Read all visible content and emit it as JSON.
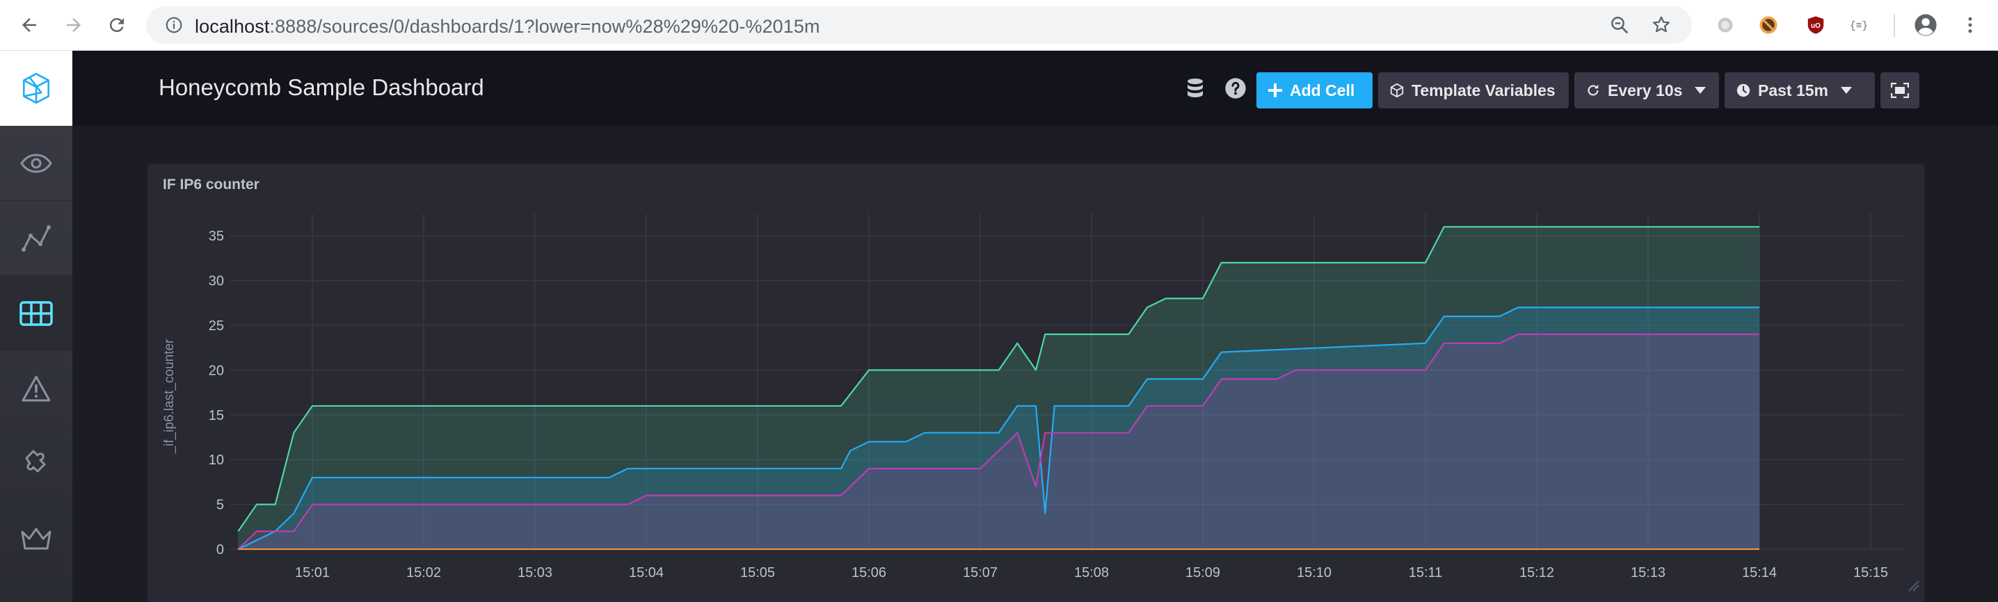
{
  "browser": {
    "url_host": "localhost",
    "url_rest": ":8888/sources/0/dashboards/1?lower=now%28%29%20-%2015m"
  },
  "header": {
    "title": "Honeycomb Sample Dashboard",
    "add_cell_label": "Add Cell",
    "template_variables_label": "Template Variables",
    "refresh_label": "Every 10s",
    "time_range_label": "Past 15m"
  },
  "sidebar": {
    "items": [
      {
        "icon": "eye-icon"
      },
      {
        "icon": "graph-icon"
      },
      {
        "icon": "dashboards-icon"
      },
      {
        "icon": "alert-icon"
      },
      {
        "icon": "puzzle-icon"
      },
      {
        "icon": "crown-icon"
      }
    ]
  },
  "colors": {
    "accent": "#22adf6",
    "series_green": "#4ed8a0",
    "series_blue": "#22adf6",
    "series_magenta": "#bf3bb3",
    "series_orange": "#f48d38"
  },
  "cell": {
    "title": "IF IP6 counter"
  },
  "chart_data": {
    "type": "area",
    "title": "IF IP6 counter",
    "xlabel": "",
    "ylabel": "_if_ip6.last_counter",
    "x_ticks": [
      "15:01",
      "15:02",
      "15:03",
      "15:04",
      "15:05",
      "15:06",
      "15:07",
      "15:08",
      "15:09",
      "15:10",
      "15:11",
      "15:12",
      "15:13",
      "15:14",
      "15:15"
    ],
    "y_ticks": [
      0,
      5,
      10,
      15,
      20,
      25,
      30,
      35
    ],
    "xlim": [
      "15:01:00",
      "15:15:00"
    ],
    "ylim": [
      0,
      37.5
    ],
    "grid": true,
    "legend": "none",
    "series": [
      {
        "color": "#4ed8a0",
        "x": [
          "15:01:20",
          "15:01:30",
          "15:01:40",
          "15:01:50",
          "15:02:00",
          "15:06:45",
          "15:07:00",
          "15:08:10",
          "15:08:20",
          "15:08:30",
          "15:08:35",
          "15:09:20",
          "15:09:30",
          "15:09:40",
          "15:10:00",
          "15:10:10",
          "15:12:00",
          "15:12:10",
          "15:15:00"
        ],
        "values": [
          2,
          5,
          5,
          13,
          16,
          16,
          20,
          20,
          23,
          20,
          24,
          24,
          27,
          28,
          28,
          32,
          32,
          36,
          36
        ]
      },
      {
        "color": "#22adf6",
        "x": [
          "15:01:20",
          "15:01:30",
          "15:01:40",
          "15:01:50",
          "15:02:00",
          "15:04:40",
          "15:04:50",
          "15:06:45",
          "15:06:50",
          "15:07:00",
          "15:07:20",
          "15:07:30",
          "15:08:10",
          "15:08:20",
          "15:08:30",
          "15:08:35",
          "15:08:40",
          "15:09:20",
          "15:09:30",
          "15:09:50",
          "15:10:00",
          "15:10:10",
          "15:12:00",
          "15:12:10",
          "15:12:40",
          "15:12:50",
          "15:15:00"
        ],
        "values": [
          0,
          1,
          2,
          4,
          8,
          8,
          9,
          9,
          11,
          12,
          12,
          13,
          13,
          16,
          16,
          4,
          16,
          16,
          19,
          19,
          19,
          22,
          23,
          26,
          26,
          27,
          27
        ]
      },
      {
        "color": "#bf3bb3",
        "x": [
          "15:01:20",
          "15:01:30",
          "15:01:40",
          "15:01:50",
          "15:02:00",
          "15:04:50",
          "15:05:00",
          "15:06:45",
          "15:07:00",
          "15:08:00",
          "15:08:20",
          "15:08:30",
          "15:08:35",
          "15:09:20",
          "15:09:30",
          "15:10:00",
          "15:10:10",
          "15:10:40",
          "15:10:50",
          "15:12:00",
          "15:12:10",
          "15:12:40",
          "15:12:50",
          "15:15:00"
        ],
        "values": [
          0,
          2,
          2,
          2,
          5,
          5,
          6,
          6,
          9,
          9,
          13,
          7,
          13,
          13,
          16,
          16,
          19,
          19,
          20,
          20,
          23,
          23,
          24,
          24
        ]
      },
      {
        "color": "#f48d38",
        "x": [
          "15:01:20",
          "15:15:00"
        ],
        "values": [
          0,
          0
        ]
      }
    ]
  }
}
